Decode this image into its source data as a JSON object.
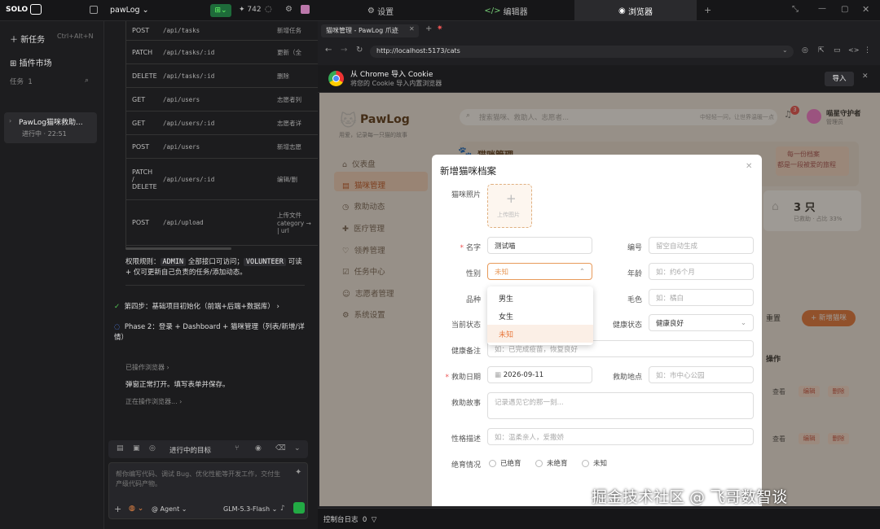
{
  "topbar": {
    "brand": "SOLO",
    "project": "pawLog",
    "count": "742",
    "tabs": [
      "设置",
      "编辑器",
      "浏览器"
    ]
  },
  "sidebar": {
    "new_task": "新任务",
    "new_task_shortcut": "Ctrl+Alt+N",
    "plugins": "插件市场",
    "tasks_label": "任务",
    "tasks_count": "1",
    "task_title": "PawLog猫咪救助...",
    "task_status": "进行中 · 22:51"
  },
  "chat": {
    "api_rows": [
      {
        "method": "POST",
        "path": "/api/tasks",
        "desc": "新增任务"
      },
      {
        "method": "PATCH",
        "path": "/api/tasks/:id",
        "desc": "更新（全"
      },
      {
        "method": "DELETE",
        "path": "/api/tasks/:id",
        "desc": "删除"
      },
      {
        "method": "GET",
        "path": "/api/users",
        "desc": "志愿者列"
      },
      {
        "method": "GET",
        "path": "/api/users/:id",
        "desc": "志愿者详"
      },
      {
        "method": "POST",
        "path": "/api/users",
        "desc": "新增志愿"
      },
      {
        "method": "PATCH / DELETE",
        "path": "/api/users/:id",
        "desc": "编辑/删"
      },
      {
        "method": "POST",
        "path": "/api/upload",
        "desc": "上传文件 category → | url"
      }
    ],
    "perm_prefix": "权限规则：",
    "perm_admin": "ADMIN",
    "perm_mid": "全部接口可访问；",
    "perm_volunteer": "VOLUNTEER",
    "perm_suffix": "可读 + 仅可更新自己负责的任务/添加动态。",
    "step4": "第四步：基础项目初始化（前端+后端+数据库）",
    "phase2": "Phase 2：登录 + Dashboard + 猫咪管理（列表/新增/详情）",
    "browser_op": "已操作浏览器",
    "dialog_msg": "弹窗正常打开。填写表单并保存。",
    "in_progress": "正在操作浏览器...",
    "goal_label": "进行中的目标",
    "input_placeholder": "帮你编写代码、调试 Bug、优化性能等开发工作，交付生产级代码产物。",
    "agent": "@ Agent",
    "model": "GLM-5.3-Flash"
  },
  "browser": {
    "tab_title": "猫咪管理 - PawLog 爪迹",
    "url": "http://localhost:5173/cats",
    "cookie_title": "从 Chrome 导入 Cookie",
    "cookie_sub": "将您的 Cookie 导入内置浏览器",
    "import_btn": "导入",
    "console": "控制台日志",
    "console_count": "0"
  },
  "app": {
    "logo": "PawLog",
    "logo_sub": "用爱，记录每一只猫的故事",
    "search_placeholder": "搜索猫咪、救助人、志愿者...",
    "search_hint": "中轻轻一问，让世界温暖一点",
    "user_name": "喵星守护者",
    "user_role": "管理员",
    "notif": "3",
    "nav": [
      "仪表盘",
      "猫咪管理",
      "救助动态",
      "医疗管理",
      "领养管理",
      "任务中心",
      "志愿者管理",
      "系统设置"
    ],
    "page_title": "猫咪管理",
    "banner_line1": "每一份档案",
    "banner_line2": "都是一段被爱的旅程",
    "stat_value": "3 只",
    "stat_sub": "已救助 · 占比 33%",
    "reset": "重置",
    "add_btn": "+ 新增猫咪",
    "ops_col": "操作",
    "view": "查看",
    "edit": "编辑",
    "delete": "删除"
  },
  "modal": {
    "title": "新增猫咪档案",
    "photo_label": "猫咪照片",
    "upload": "上传图片",
    "name_label": "名字",
    "name_value": "测试喵",
    "code_label": "编号",
    "code_placeholder": "留空自动生成",
    "gender_label": "性别",
    "gender_value": "未知",
    "age_label": "年龄",
    "age_placeholder": "如：约6个月",
    "breed_label": "品种",
    "color_label": "毛色",
    "color_placeholder": "如：橘白",
    "status_label": "当前状态",
    "health_label": "健康状态",
    "health_value": "健康良好",
    "note_label": "健康备注",
    "note_placeholder": "如：已完成疫苗，恢复良好",
    "date_label": "救助日期",
    "date_value": "2026-09-11",
    "place_label": "救助地点",
    "place_placeholder": "如：市中心公园",
    "story_label": "救助故事",
    "story_placeholder": "记录遇见它的那一刻...",
    "personality_label": "性格描述",
    "personality_placeholder": "如：温柔亲人，爱撒娇",
    "neuter_label": "绝育情况",
    "neuter_options": [
      "已绝育",
      "未绝育",
      "未知"
    ],
    "gender_options": [
      "男生",
      "女生",
      "未知"
    ]
  },
  "watermark": "掘金技术社区 @ 飞哥数智谈"
}
